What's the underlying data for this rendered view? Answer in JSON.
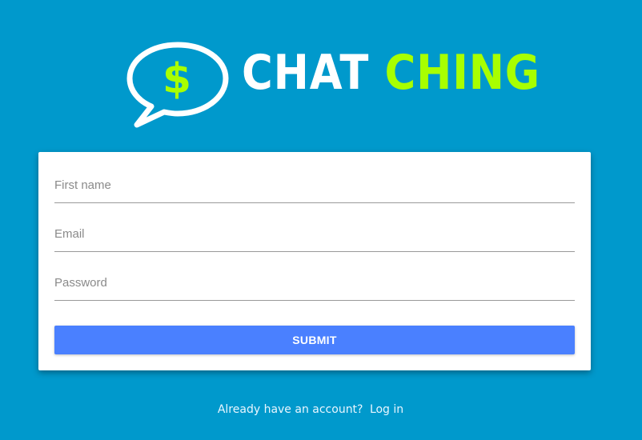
{
  "brand": {
    "word1": "CHAT",
    "word2": "CHING",
    "icon_symbol": "$",
    "icon": "speech-bubble-dollar-icon",
    "colors": {
      "background": "#0099cc",
      "primary_text": "#ffffff",
      "accent": "#a8ff00"
    }
  },
  "form": {
    "first_name": {
      "placeholder": "First name",
      "value": ""
    },
    "email": {
      "placeholder": "Email",
      "value": ""
    },
    "password": {
      "placeholder": "Password",
      "value": ""
    },
    "submit_label": "SUBMIT",
    "submit_color": "#4a80ff"
  },
  "footer": {
    "prompt": "Already have an account?",
    "login_link": "Log in"
  }
}
